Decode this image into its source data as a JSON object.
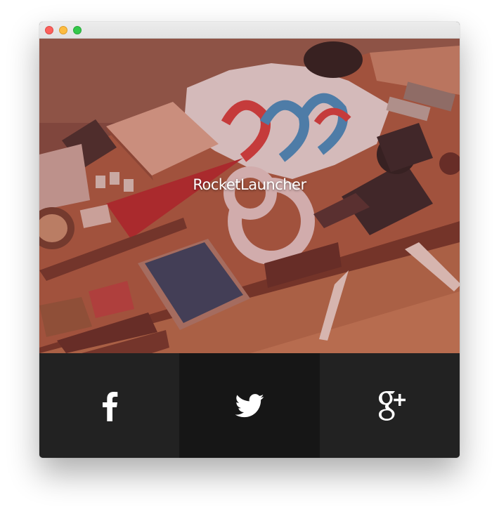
{
  "window": {
    "controls": [
      "close",
      "minimize",
      "zoom"
    ]
  },
  "hero": {
    "brand": "RocketLauncher",
    "image_description_icon": "flat-lay-photo"
  },
  "social": {
    "buttons": [
      {
        "name": "facebook",
        "icon": "facebook-icon"
      },
      {
        "name": "twitter",
        "icon": "twitter-icon"
      },
      {
        "name": "google-plus",
        "icon": "google-plus-icon"
      }
    ]
  },
  "colors": {
    "window_bg": "#1f1f1f",
    "social_dark": "#222222",
    "social_mid": "#161616",
    "brand_text": "#ffffff"
  }
}
